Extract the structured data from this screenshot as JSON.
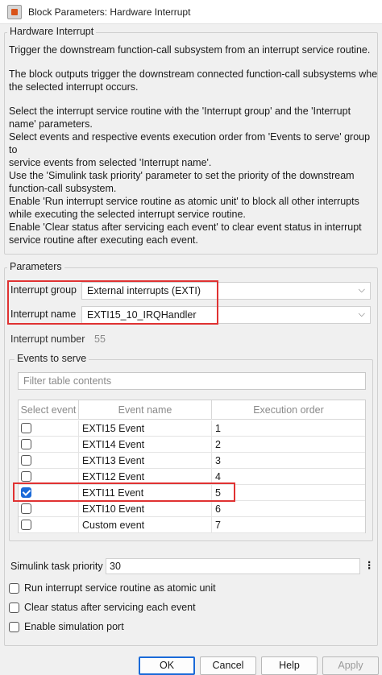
{
  "window": {
    "title": "Block Parameters: Hardware Interrupt"
  },
  "block": {
    "legend": "Hardware Interrupt",
    "description": [
      "Trigger the downstream function-call subsystem from an interrupt service routine.",
      "The block outputs trigger the downstream connected function-call subsystems whe\nthe selected interrupt occurs.",
      "Select the interrupt service routine with the 'Interrupt group' and the 'Interrupt\nname' parameters.\nSelect events and respective events execution order from 'Events to serve' group to\nservice events from selected 'Interrupt name'.\nUse the 'Simulink task priority' parameter to set the priority of the downstream\nfunction-call subsystem.\nEnable 'Run interrupt service routine as atomic unit' to block all other interrupts\nwhile executing the selected interrupt service routine.\nEnable 'Clear status after servicing each event' to clear event status in interrupt\nservice routine after executing each event."
    ]
  },
  "parameters": {
    "legend": "Parameters",
    "interrupt_group": {
      "label": "Interrupt group",
      "value": "External interrupts (EXTI)"
    },
    "interrupt_name": {
      "label": "Interrupt name",
      "value": "EXTI15_10_IRQHandler"
    },
    "interrupt_number": {
      "label": "Interrupt number",
      "value": "55"
    }
  },
  "events": {
    "legend": "Events to serve",
    "filter_placeholder": "Filter table contents",
    "columns": [
      "Select event",
      "Event name",
      "Execution order"
    ],
    "rows": [
      {
        "checked": false,
        "name": "EXTI15 Event",
        "order": "1"
      },
      {
        "checked": false,
        "name": "EXTI14 Event",
        "order": "2"
      },
      {
        "checked": false,
        "name": "EXTI13 Event",
        "order": "3"
      },
      {
        "checked": false,
        "name": "EXTI12 Event",
        "order": "4"
      },
      {
        "checked": true,
        "name": "EXTI11 Event",
        "order": "5"
      },
      {
        "checked": false,
        "name": "EXTI10 Event",
        "order": "6"
      },
      {
        "checked": false,
        "name": "Custom event",
        "order": "7"
      }
    ]
  },
  "priority": {
    "label": "Simulink task priority",
    "value": "30",
    "menu": "⋮"
  },
  "options": {
    "atomic": "Run interrupt service routine as atomic unit",
    "clear_status": "Clear status after servicing each event",
    "sim_port": "Enable simulation port"
  },
  "buttons": {
    "ok": "OK",
    "cancel": "Cancel",
    "help": "Help",
    "apply": "Apply"
  },
  "icons": {
    "chevron": "⌵"
  },
  "colors": {
    "highlight": "#e03232",
    "accent": "#1a6ad8"
  }
}
